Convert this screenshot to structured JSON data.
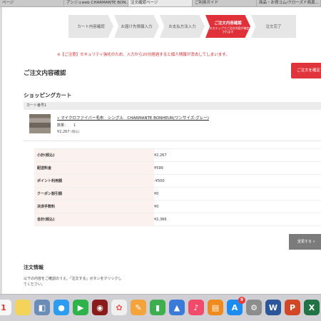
{
  "browser_tabs": [
    {
      "label": "ページ",
      "active": false
    },
    {
      "label": "アンジュweb CHARMANTE BON...",
      "active": false
    },
    {
      "label": "注文確認ページ",
      "active": true
    },
    {
      "label": "ご利用ガイド",
      "active": false
    },
    {
      "label": "商品・お得コム/クローズド商真...",
      "active": false
    }
  ],
  "steps": [
    {
      "label": "カート内容確認",
      "sub": ""
    },
    {
      "label": "お届け先情報入力",
      "sub": ""
    },
    {
      "label": "お支払方法入力",
      "sub": ""
    },
    {
      "label": "ご注文内容確認",
      "sub": "このステップでご注文内容が確定されます",
      "active": true
    },
    {
      "label": "注文完了",
      "sub": ""
    }
  ],
  "notice": "※【ご注意】セキュリティ強化のため、入力から20分経過すると個人情報が消去してしまいます。",
  "confirm_title": "ご注文内容確認",
  "confirm_button": "ご注文を確定",
  "cart_title": "ショッピングカート",
  "cart_number_label": "カート番号1",
  "item": {
    "name": "» マイクロファイバー毛布　シングル　CHARMANTE BONHEUR(ワンサイズ-グレー)",
    "qty_label": "数量：",
    "qty": "1",
    "price": "¥2,267",
    "tax_note": "(税込)"
  },
  "summary": [
    {
      "label": "小計(税込)",
      "value": "¥2,267"
    },
    {
      "label": "配送料金",
      "value": "¥599"
    },
    {
      "label": "ポイント利用額",
      "value": "-¥500"
    },
    {
      "label": "クーポン割引額",
      "value": "¥0"
    },
    {
      "label": "決済手数料",
      "value": "¥0"
    },
    {
      "label": "合計(税込)",
      "value": "¥2,366"
    }
  ],
  "change_button": "変更する »",
  "order_info_title": "注文情報",
  "order_info_desc": "以下の内容をご確認のうえ、「注文する」ボタンをクリックしてください。",
  "dock": [
    {
      "name": "calendar-icon",
      "glyph": "1",
      "bg": "#f7f7f7",
      "fg": "#d33"
    },
    {
      "name": "notes-icon",
      "glyph": "",
      "bg": "#f3d35a",
      "fg": "#fff"
    },
    {
      "name": "preview-icon",
      "glyph": "◧",
      "bg": "#6c8cb8",
      "fg": "#fff"
    },
    {
      "name": "messages-icon",
      "glyph": "●",
      "bg": "#2b9cf2",
      "fg": "#fff"
    },
    {
      "name": "facetime-icon",
      "glyph": "▶",
      "bg": "#2eb34b",
      "fg": "#fff"
    },
    {
      "name": "photo-booth-icon",
      "glyph": "◉",
      "bg": "#8a1b1b",
      "fg": "#fff"
    },
    {
      "name": "photos-icon",
      "glyph": "✿",
      "bg": "#f0f0f0",
      "fg": "#e55"
    },
    {
      "name": "pages-icon",
      "glyph": "✎",
      "bg": "#f4a43a",
      "fg": "#fff"
    },
    {
      "name": "numbers-icon",
      "glyph": "▮",
      "bg": "#3fae4f",
      "fg": "#fff"
    },
    {
      "name": "keynote-icon",
      "glyph": "▲",
      "bg": "#3b7ad8",
      "fg": "#fff"
    },
    {
      "name": "music-icon",
      "glyph": "♪",
      "bg": "#f24a6a",
      "fg": "#fff"
    },
    {
      "name": "books-icon",
      "glyph": "▤",
      "bg": "#f08a1c",
      "fg": "#fff"
    },
    {
      "name": "app-store-icon",
      "glyph": "A",
      "bg": "#1d8cf0",
      "fg": "#fff",
      "badge": "9"
    },
    {
      "name": "system-preferences-icon",
      "glyph": "⚙",
      "bg": "#8d8d8d",
      "fg": "#fff"
    },
    {
      "name": "word-icon",
      "glyph": "W",
      "bg": "#2b579a",
      "fg": "#fff"
    },
    {
      "name": "powerpoint-icon",
      "glyph": "P",
      "bg": "#d24726",
      "fg": "#fff"
    },
    {
      "name": "excel-icon",
      "glyph": "X",
      "bg": "#217346",
      "fg": "#fff"
    }
  ]
}
